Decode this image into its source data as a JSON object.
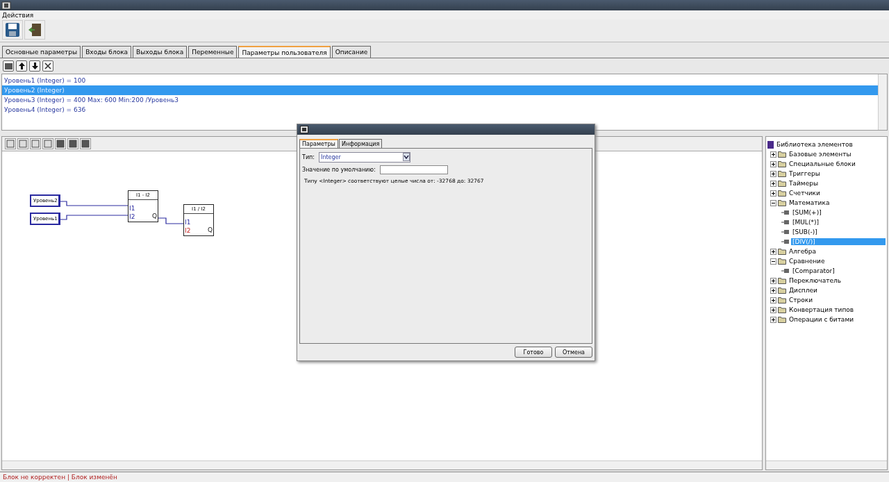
{
  "menu": [
    "Действия"
  ],
  "tabs": [
    {
      "label": "Основные параметры",
      "selected": false
    },
    {
      "label": "Входы блока",
      "selected": false
    },
    {
      "label": "Выходы блока",
      "selected": false
    },
    {
      "label": "Переменные",
      "selected": false
    },
    {
      "label": "Параметры пользователя",
      "selected": true
    },
    {
      "label": "Описание",
      "selected": false
    }
  ],
  "parameters": [
    {
      "text": "Уровень1 (Integer) = 100",
      "selected": false
    },
    {
      "text": "Уровень2 (Integer)",
      "selected": true
    },
    {
      "text": "Уровень3 (Integer) = 400 Max: 600 Min:200 /Уровень3",
      "selected": false
    },
    {
      "text": "Уровень4 (Integer) = 636",
      "selected": false
    }
  ],
  "diagram": {
    "inputs": [
      "Уровень2",
      "Уровень1"
    ],
    "blocks": [
      {
        "title": "I1 - I2",
        "pins": [
          "I1",
          "I2"
        ],
        "output": "Q"
      },
      {
        "title": "I1 / I2",
        "pins": [
          "I1",
          "I2"
        ],
        "output": "Q"
      }
    ]
  },
  "library": {
    "title": "Библиотека элементов",
    "items": [
      {
        "label": "Базовые элементы",
        "kind": "folder",
        "expanded": false,
        "selected": false
      },
      {
        "label": "Специальные блоки",
        "kind": "folder",
        "expanded": false,
        "selected": false
      },
      {
        "label": "Триггеры",
        "kind": "folder",
        "expanded": false,
        "selected": false
      },
      {
        "label": "Таймеры",
        "kind": "folder",
        "expanded": false,
        "selected": false
      },
      {
        "label": "Счетчики",
        "kind": "folder",
        "expanded": false,
        "selected": false
      },
      {
        "label": "Математика",
        "kind": "folder",
        "expanded": true,
        "selected": false,
        "children": [
          {
            "label": "[SUM(+)]",
            "kind": "leaf",
            "selected": false
          },
          {
            "label": "[MUL(*)]",
            "kind": "leaf",
            "selected": false
          },
          {
            "label": "[SUB(-)]",
            "kind": "leaf",
            "selected": false
          },
          {
            "label": "[DIV(/)]",
            "kind": "leaf",
            "selected": true
          }
        ]
      },
      {
        "label": "Алгебра",
        "kind": "folder",
        "expanded": false,
        "selected": false
      },
      {
        "label": "Сравнение",
        "kind": "folder",
        "expanded": true,
        "selected": false,
        "children": [
          {
            "label": "[Comparator]",
            "kind": "leaf",
            "selected": false
          }
        ]
      },
      {
        "label": "Переключатель",
        "kind": "folder",
        "expanded": false,
        "selected": false
      },
      {
        "label": "Дисплеи",
        "kind": "folder",
        "expanded": false,
        "selected": false
      },
      {
        "label": "Строки",
        "kind": "folder",
        "expanded": false,
        "selected": false
      },
      {
        "label": "Конвертация типов",
        "kind": "folder",
        "expanded": false,
        "selected": false
      },
      {
        "label": "Операции с битами",
        "kind": "folder",
        "expanded": false,
        "selected": false
      }
    ]
  },
  "dialog": {
    "tabs": [
      {
        "label": "Параметры",
        "selected": true
      },
      {
        "label": "Информация",
        "selected": false
      }
    ],
    "type_label": "Тип:",
    "type_value": "Integer",
    "default_label": "Значение по умолчанию:",
    "hint": "Типу <Integer> соответствуют целые числа от: -32768 до: 32767",
    "buttons": [
      "Готово",
      "Отмена"
    ]
  },
  "status_bar": "Блок не корректен | Блок изменён"
}
